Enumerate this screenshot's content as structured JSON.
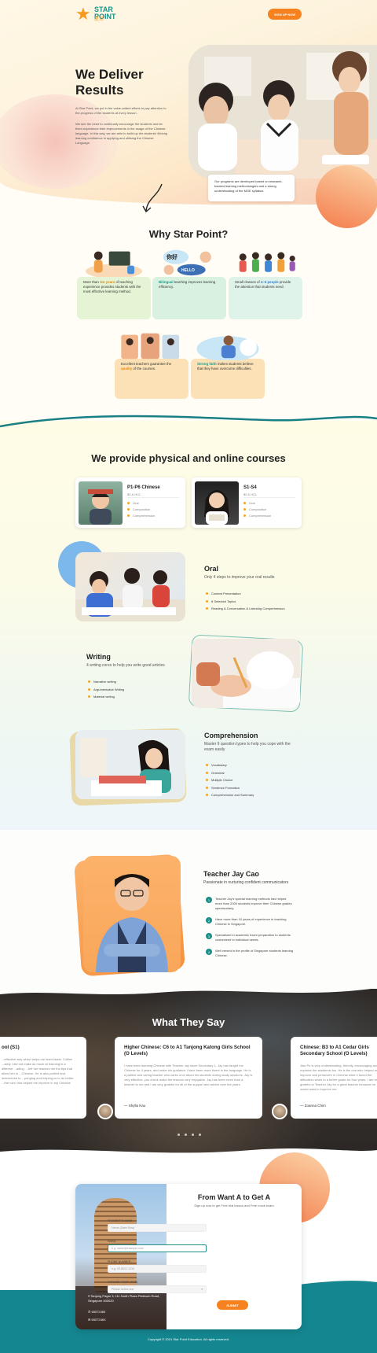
{
  "brand": {
    "name": "STAR POINT",
    "sub_cn": "星点",
    "accent": "#f5821f",
    "teal": "#1d8f88"
  },
  "header": {
    "signup_label": "SIGN UP NOW"
  },
  "hero": {
    "title": "We Deliver Results",
    "p1": "At Star Point, we put in the value-added efforts to pay attention to the progress of the students at every lesson.",
    "p2": "We see the need to continually encourage the students and let them experience their improvements in the usage of the Chinese language. In this way, we are able to build up the students' lifelong learning confidence in applying and utilising the Chinese Language.",
    "caption": "Our programs are developed based on research-backed learning methodologies and a strong understanding of the MOE syllabus."
  },
  "why": {
    "title": "Why Star Point?",
    "cards": [
      {
        "pre": "More than ",
        "hl": "ten years",
        "post": " of teaching experience provides students with the most effective learning method."
      },
      {
        "pre": "",
        "hl": "Bilingual",
        "post": " teaching improves learning efficiency."
      },
      {
        "pre": "Small classes of ",
        "hl": "4–5 people",
        "post": " provide the attention that students need."
      },
      {
        "pre": "Excellent teachers guarantee the ",
        "hl": "quality",
        "post": " of the courses."
      },
      {
        "pre": "",
        "hl": "Strong faith",
        "post": " makes students believe that they have overcome difficulties."
      }
    ],
    "bubble1": "你好",
    "bubble2": "HELLO"
  },
  "courses": {
    "title": "We provide physical and online courses",
    "items": [
      {
        "name": "P1-P6 Chinese",
        "sub": "$0 & HCL",
        "bullets": [
          "Oral",
          "Composition",
          "Comprehension"
        ]
      },
      {
        "name": "S1-S4",
        "sub": "$0 & HCL",
        "bullets": [
          "Oral",
          "Composition",
          "Comprehension"
        ]
      }
    ]
  },
  "features": {
    "oral": {
      "title": "Oral",
      "sub": "Only 4 steps to improve your oral results",
      "items": [
        "Content Presentation",
        "6 Selected Topics",
        "Reading & Conversation & Listening Comprehension"
      ]
    },
    "writing": {
      "title": "Writing",
      "sub": "4 writing cores to help you write good articles",
      "items": [
        "Narrative writing",
        "Argumentative Writing",
        "Material writing"
      ]
    },
    "comprehension": {
      "title": "Comprehension",
      "sub": "Master 9 question types to help you cope with the exam easily",
      "items": [
        "Vocabulary",
        "Grammar",
        "Multiple Choice",
        "Sentence Formation",
        "Comprehension and Summary"
      ]
    }
  },
  "teacher": {
    "name": "Teacher Jay Cao",
    "tagline": "Passionate in nurturing confident communicators",
    "points": [
      "Teacher Jay's special learning methods has helped more than 2000 students improve their Chinese grades spectacularly.",
      "Have more than 10 years of experience in teaching Chinese in Singapore.",
      "Specialized in academic exam preparation to students customized to individual needs.",
      "Well versed in the profile of Singapore students learning Chinese."
    ]
  },
  "testimonials": {
    "title": "What They Say",
    "cards": [
      {
        "title": "ool (S1)",
        "body": "...effective way which helps me learn faster. Coffee ...ately I did not make as much at learning in a different ...ading. ...left her teaches me the tips that allow him to ...Chinese. He is also patient and determined to ...ponging and helping us to do better. ...ther who has helped me improve in my Chinese.",
        "author": ""
      },
      {
        "title": "Higher Chinese: C6 to A1 Tanjong Katong Girls School (O Levels)",
        "body": "I have been learning Chinese with Teacher Jay since Secondary 1. Jay has taught me Chinese for 4 years, and under his guidance I have been more fluent in the language. He is a patient and caring teacher who cares a lot about his students during study sessions. Jay is very effective, you check make the lessons very enjoyable. Jay has been more than a teacher to me and I am very grateful for all of the support and advice over the years.",
        "author": "— Shylla Kao"
      },
      {
        "title": "Chinese: B3 to A1 Cedar Girls Secondary School (O Levels)",
        "body": "Jiao Pu is very understanding, friendly, encouraging and explains the academic too. He is the one who helped me improve and persevere in Chinese when I faced the difficulties when to a better grade for four years. I am very grateful to Teacher Jay for a great teacher because he would want to improve me.",
        "author": "— Zoanna Chim"
      }
    ]
  },
  "contact": {
    "title": "From Want A to Get A",
    "subtitle": "Sign up now to get Free trial lesson and Free mock exam",
    "address": "Tanjong Pagar 3, 111 North Plaza Platinum Road, Singapore 400020",
    "phone": "65072460",
    "email": "6507246X",
    "labels": {
      "name": "STUDENT'S NAME",
      "email": "EMAIL",
      "phone": "PHONE NUMBER",
      "level": "CHOOSE YOUR LEVEL"
    },
    "placeholders": {
      "name": "Name (Sabe Bow)",
      "email": "e.g. name@example.com",
      "phone": "e.g. 93 8012 1234",
      "level": "Please select one"
    },
    "submit": "SUBMIT"
  },
  "footer": {
    "copyright": "Copyright © 2021 Star Point Education. All rights reserved."
  }
}
